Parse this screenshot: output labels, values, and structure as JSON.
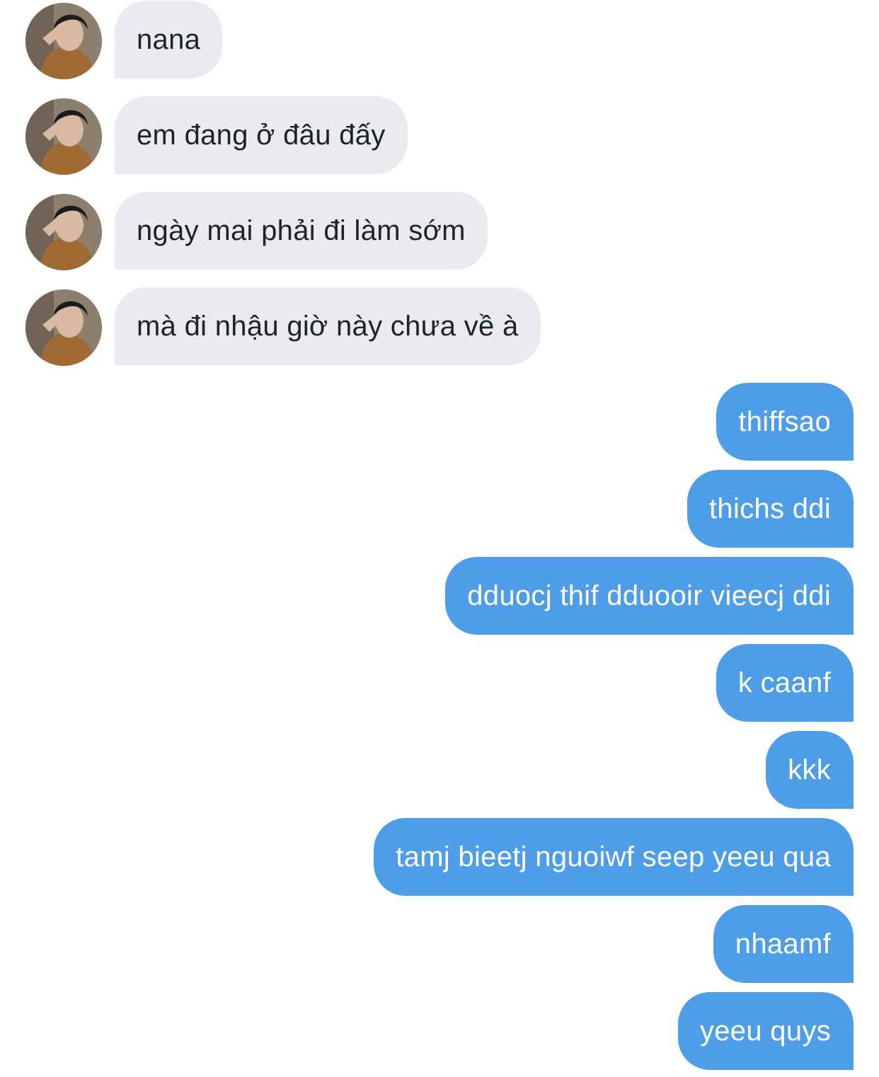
{
  "conversation": {
    "incoming": [
      {
        "text": "nana",
        "avatar_icon": "user-avatar-photo"
      },
      {
        "text": "em đang ở đâu đấy",
        "avatar_icon": "user-avatar-photo"
      },
      {
        "text": "ngày mai phải đi làm sớm",
        "avatar_icon": "user-avatar-photo"
      },
      {
        "text": "mà đi nhậu giờ này chưa về à",
        "avatar_icon": "user-avatar-photo"
      }
    ],
    "outgoing": [
      {
        "text": "thiffsao"
      },
      {
        "text": "thichs ddi"
      },
      {
        "text": "dduocj thif dduooir vieecj ddi"
      },
      {
        "text": "k caanf"
      },
      {
        "text": "kkk"
      },
      {
        "text": "tamj bieetj nguoiwf seep yeeu qua"
      },
      {
        "text": "nhaamf"
      },
      {
        "text": "yeeu quys"
      }
    ]
  },
  "colors": {
    "incoming_bubble": "#e9ebf0",
    "incoming_text": "#1f2328",
    "outgoing_bubble": "#4d9de8",
    "outgoing_text": "#ffffff"
  }
}
